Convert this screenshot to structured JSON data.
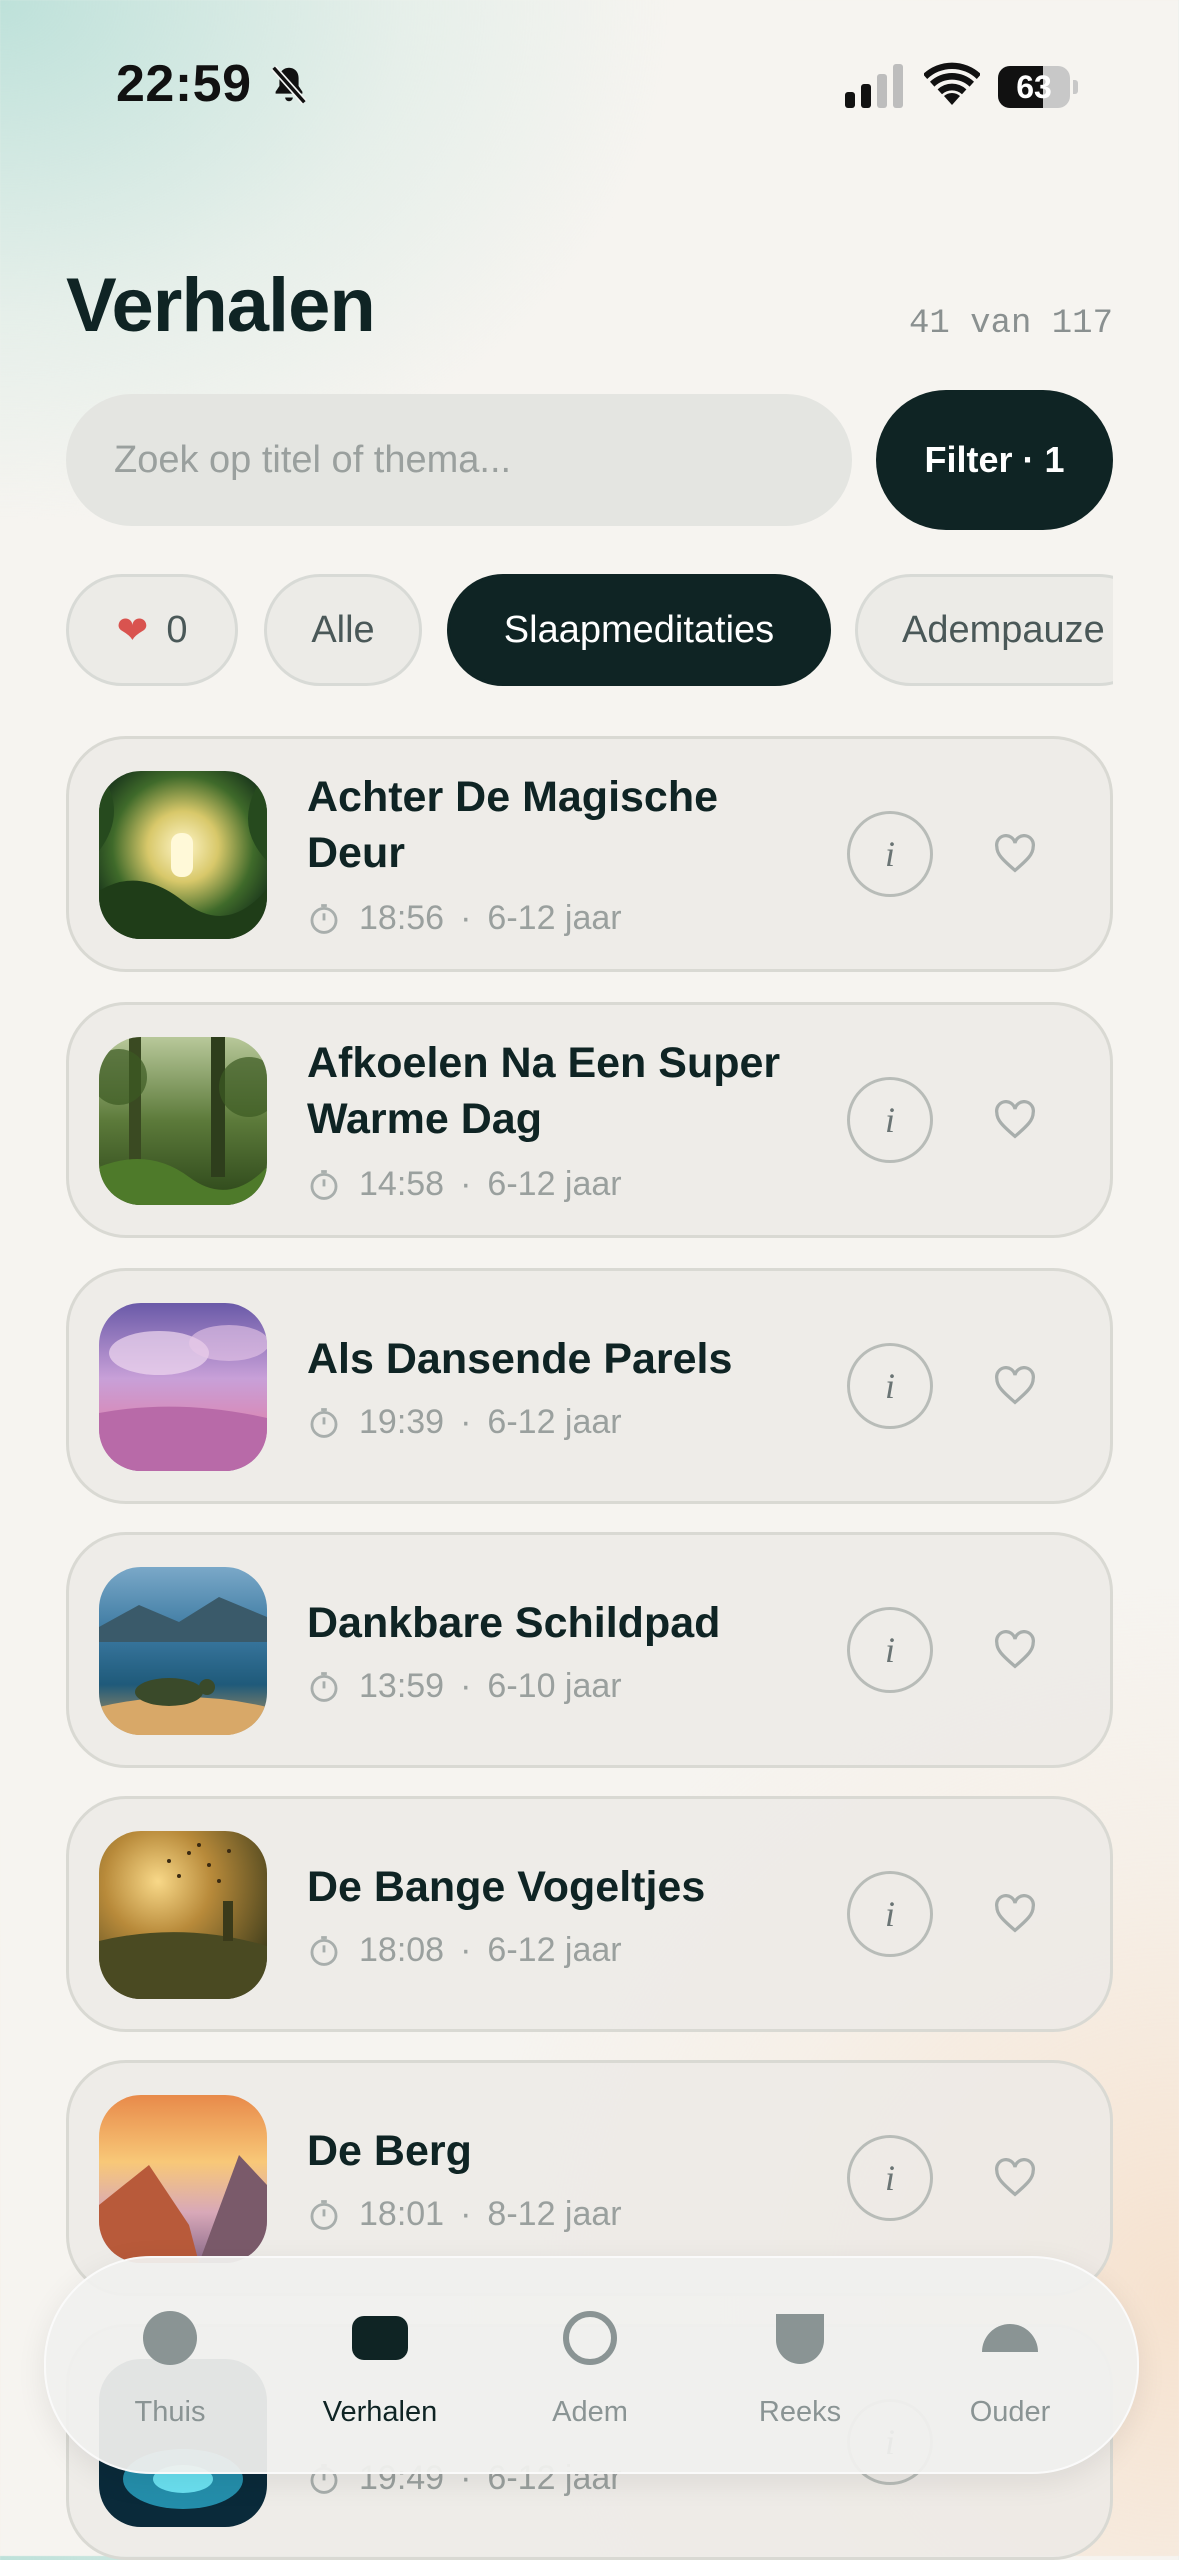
{
  "status_bar": {
    "time": "22:59",
    "battery": "63",
    "battery_level": 0.63
  },
  "header": {
    "title": "Verhalen",
    "count": "41 van 117"
  },
  "search": {
    "placeholder": "Zoek op titel of thema...",
    "value": ""
  },
  "filter": {
    "label": "Filter · 1"
  },
  "chips": [
    {
      "label": "0",
      "icon": "heart-icon"
    },
    {
      "label": "Alle"
    },
    {
      "label": "Slaapmeditaties",
      "active": true
    },
    {
      "label": "Adempauze"
    }
  ],
  "stories": [
    {
      "title": "Achter De Magische Deur",
      "duration": "18:56",
      "age": "6-12 jaar"
    },
    {
      "title": "Afkoelen Na Een Super Warme Dag",
      "duration": "14:58",
      "age": "6-12 jaar"
    },
    {
      "title": "Als Dansende Parels",
      "duration": "19:39",
      "age": "6-12 jaar"
    },
    {
      "title": "Dankbare Schildpad",
      "duration": "13:59",
      "age": "6-10 jaar"
    },
    {
      "title": "De Bange Vogeltjes",
      "duration": "18:08",
      "age": "6-12 jaar"
    },
    {
      "title": "De Berg",
      "duration": "18:01",
      "age": "8-12 jaar"
    },
    {
      "title": "",
      "duration": "19:49",
      "age": "6-12 jaar"
    }
  ],
  "tabs": [
    {
      "label": "Thuis"
    },
    {
      "label": "Verhalen",
      "active": true
    },
    {
      "label": "Adem"
    },
    {
      "label": "Reeks"
    },
    {
      "label": "Ouder"
    }
  ],
  "colors": {
    "accent": "#0f2424",
    "muted": "#9aa09e",
    "heart": "#d9534f"
  }
}
